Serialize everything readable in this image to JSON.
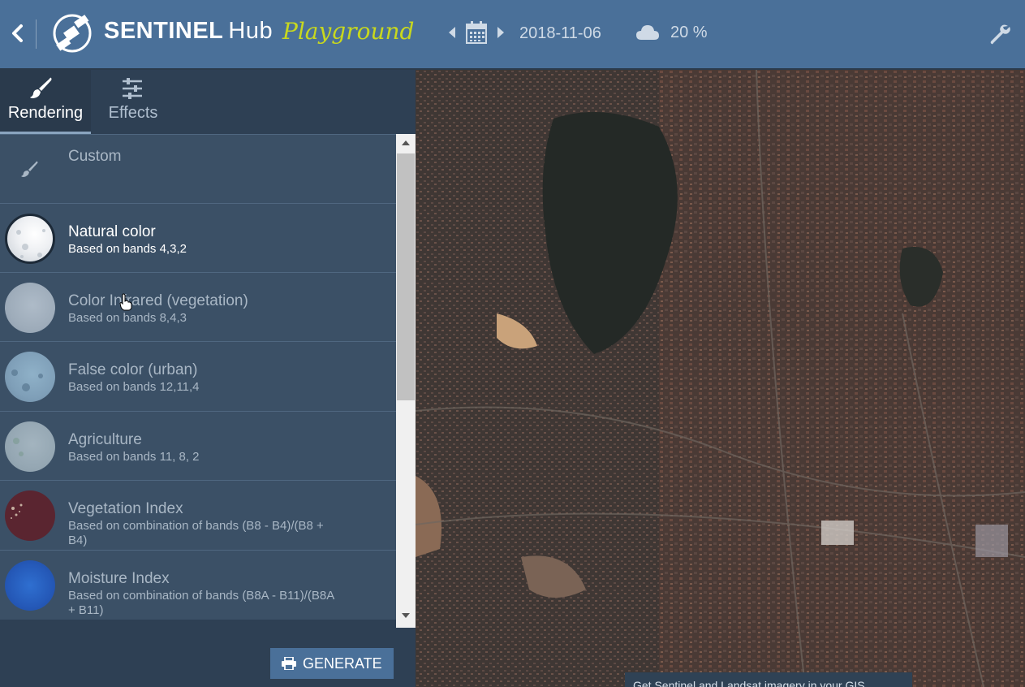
{
  "header": {
    "brand_bold": "SENTINEL",
    "brand_light": "Hub",
    "playground": "Playground",
    "date": "2018-11-06",
    "cloud_coverage": "20 %"
  },
  "tabs": [
    {
      "label": "Rendering",
      "icon": "paintbrush-icon",
      "active": true
    },
    {
      "label": "Effects",
      "icon": "sliders-icon",
      "active": false
    }
  ],
  "layers": [
    {
      "title": "Custom",
      "desc": "",
      "icon": "paintbrush-icon"
    },
    {
      "title": "Natural color",
      "desc": "Based on bands 4,3,2",
      "selected": true
    },
    {
      "title": "Color Infrared (vegetation)",
      "desc": "Based on bands 8,4,3"
    },
    {
      "title": "False color (urban)",
      "desc": "Based on bands 12,11,4"
    },
    {
      "title": "Agriculture",
      "desc": "Based on bands 11, 8, 2"
    },
    {
      "title": "Vegetation Index",
      "desc": "Based on combination of bands (B8 - B4)/(B8 + B4)"
    },
    {
      "title": "Moisture Index",
      "desc": "Based on combination of bands (B8A - B11)/(B8A + B11)"
    }
  ],
  "generate_label": "GENERATE",
  "map_banner": "Get Sentinel and Landsat imagery in your GIS",
  "colors": {
    "header_bg": "#4a7099",
    "sidebar_bg": "#2e4054",
    "item_bg": "#3b5066",
    "playground_accent": "#c8d81e"
  }
}
